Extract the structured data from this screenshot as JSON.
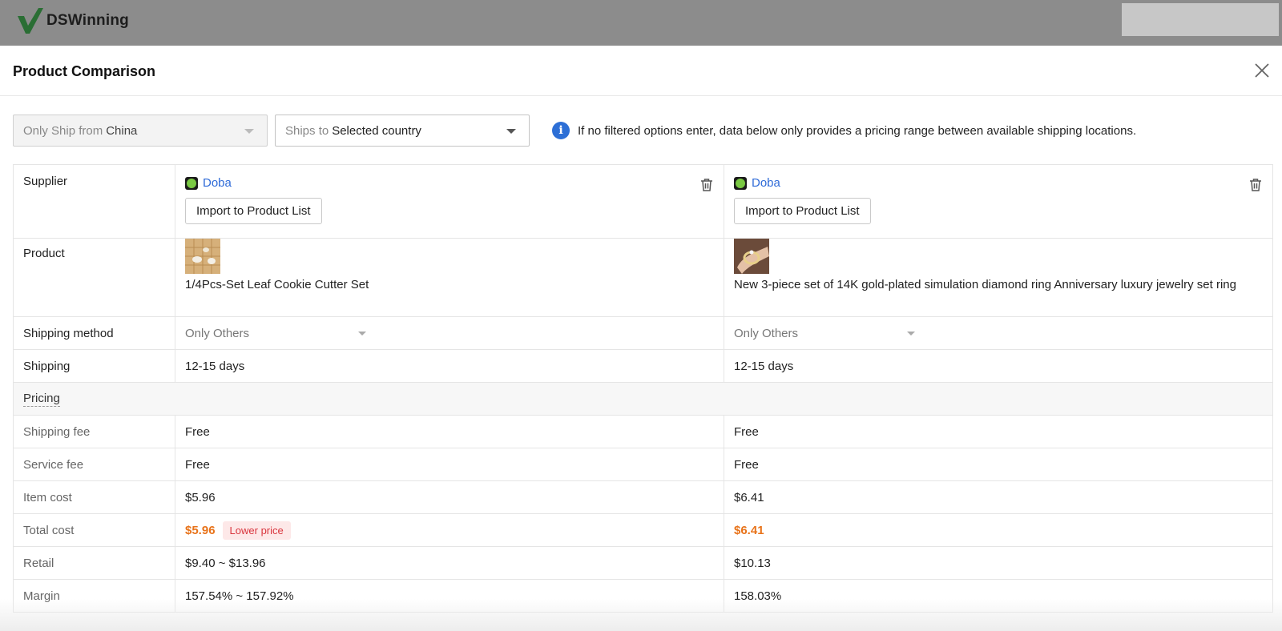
{
  "app": {
    "name": "DSWinning"
  },
  "modal": {
    "title": "Product Comparison"
  },
  "filters": {
    "ship_from": {
      "prefix": "Only Ship from",
      "value": "China"
    },
    "ships_to": {
      "prefix": "Ships to",
      "value": "Selected country"
    },
    "info_text": "If no filtered options enter, data below only provides a pricing range between available shipping locations."
  },
  "labels": {
    "supplier": "Supplier",
    "product": "Product",
    "shipping_method": "Shipping method",
    "shipping": "Shipping",
    "pricing": "Pricing",
    "shipping_fee": "Shipping fee",
    "service_fee": "Service fee",
    "item_cost": "Item cost",
    "total_cost": "Total cost",
    "retail": "Retail",
    "margin": "Margin"
  },
  "import_label": "Import to Product List",
  "products": [
    {
      "supplier": "Doba",
      "name": "1/4Pcs-Set Leaf Cookie Cutter Set",
      "shipping_method": "Only Others",
      "shipping": "12-15 days",
      "shipping_fee": "Free",
      "service_fee": "Free",
      "item_cost": "$5.96",
      "total_cost": "$5.96",
      "badge": "Lower price",
      "retail": "$9.40 ~ $13.96",
      "margin": "157.54% ~ 157.92%"
    },
    {
      "supplier": "Doba",
      "name": "New 3-piece set of 14K gold-plated simulation diamond ring Anniversary luxury jewelry set ring",
      "shipping_method": "Only Others",
      "shipping": "12-15 days",
      "shipping_fee": "Free",
      "service_fee": "Free",
      "item_cost": "$6.41",
      "total_cost": "$6.41",
      "retail": "$10.13",
      "margin": "158.03%"
    }
  ],
  "colors": {
    "accent_blue": "#2f6bd8",
    "total_orange": "#e8731a",
    "badge_red": "#d9363e",
    "logo_green": "#2e8b3d"
  }
}
